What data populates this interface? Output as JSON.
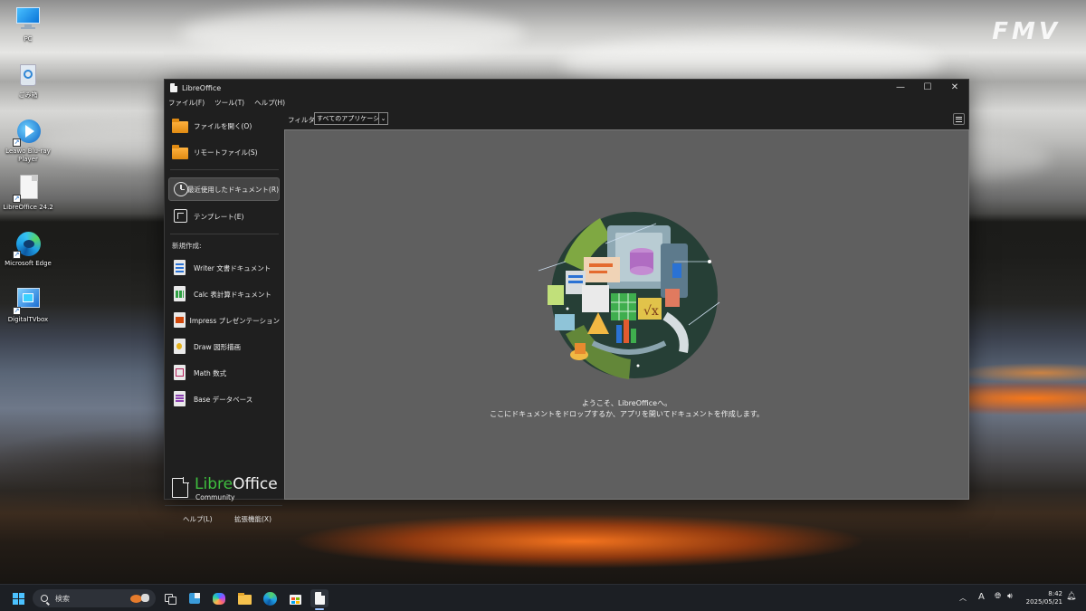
{
  "desktop": {
    "watermark": "FMV",
    "icons": [
      {
        "label": "PC",
        "icon": "monitor-icon"
      },
      {
        "label": "ごみ箱",
        "icon": "recycle-bin-icon"
      },
      {
        "label": "Leawo Blu-ray Player",
        "icon": "leawo-player-icon"
      },
      {
        "label": "LibreOffice 24.2",
        "icon": "libreoffice-shortcut-icon"
      },
      {
        "label": "Microsoft Edge",
        "icon": "edge-icon"
      },
      {
        "label": "DigitalTVbox",
        "icon": "digitaltvbox-icon"
      }
    ]
  },
  "window": {
    "title": "LibreOffice",
    "controls": {
      "minimize": "—",
      "maximize": "☐",
      "close": "✕"
    },
    "menu": [
      "ファイル(F)",
      "ツール(T)",
      "ヘルプ(H)"
    ]
  },
  "sidebar": {
    "open_file": "ファイルを開く(O)",
    "remote_files": "リモートファイル(S)",
    "recent_documents": "最近使用したドキュメント(R)",
    "templates": "テンプレート(E)",
    "create_heading": "新規作成:",
    "create_items": [
      {
        "label": "Writer 文書ドキュメント",
        "color": "#2a72d4",
        "icon": "writer-icon"
      },
      {
        "label": "Calc 表計算ドキュメント",
        "color": "#2fa043",
        "icon": "calc-icon"
      },
      {
        "label": "Impress プレゼンテーション",
        "color": "#d1480c",
        "icon": "impress-icon"
      },
      {
        "label": "Draw 図形描画",
        "color": "#e5b21d",
        "icon": "draw-icon"
      },
      {
        "label": "Math 数式",
        "color": "#b6205a",
        "icon": "math-icon"
      },
      {
        "label": "Base データベース",
        "color": "#8a3fb0",
        "icon": "base-icon"
      }
    ],
    "logo": {
      "name_green": "Libre",
      "name_white": "Office",
      "edition": "Community"
    },
    "footer": {
      "help": "ヘルプ(L)",
      "extensions": "拡張機能(X)"
    }
  },
  "filter": {
    "label": "フィルター:",
    "value": "すべてのアプリケーション"
  },
  "content": {
    "welcome_line1": "ようこそ、LibreOfficeへ。",
    "welcome_line2": "ここにドキュメントをドロップするか、アプリを開いてドキュメントを作成します。"
  },
  "taskbar": {
    "search_placeholder": "検索",
    "time": "8:42",
    "date": "2025/05/21",
    "ime": "A"
  },
  "colors": {
    "window_bg": "#1f1f1f",
    "content_bg": "#5f5f5f",
    "logo_green": "#3fbf3f"
  }
}
